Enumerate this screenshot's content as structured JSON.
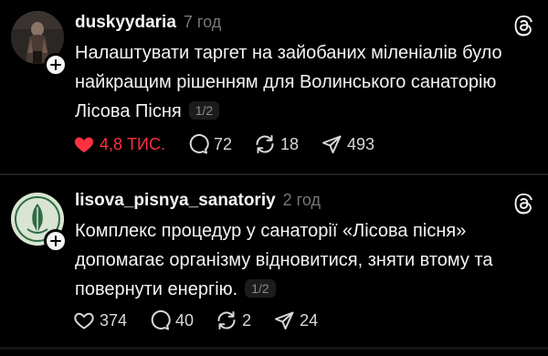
{
  "posts": [
    {
      "username": "duskyydaria",
      "time": "7 год",
      "text": "Налаштувати таргет на зайобаних міленіалів було найкращим рішенням для Волинського санаторію Лісова Пісня",
      "pager": "1/2",
      "likes": "4,8 ТИС.",
      "comments": "72",
      "reposts": "18",
      "shares": "493",
      "liked": true,
      "like_color": "#ff3040"
    },
    {
      "username": "lisova_pisnya_sanatoriy",
      "time": "2 год",
      "text": "Комплекс процедур у санаторії «Лісова пісня» допомагає організму відновитися, зняти втому та повернути енергію.",
      "pager": "1/2",
      "likes": "374",
      "comments": "40",
      "reposts": "2",
      "shares": "24",
      "liked": false
    }
  ]
}
